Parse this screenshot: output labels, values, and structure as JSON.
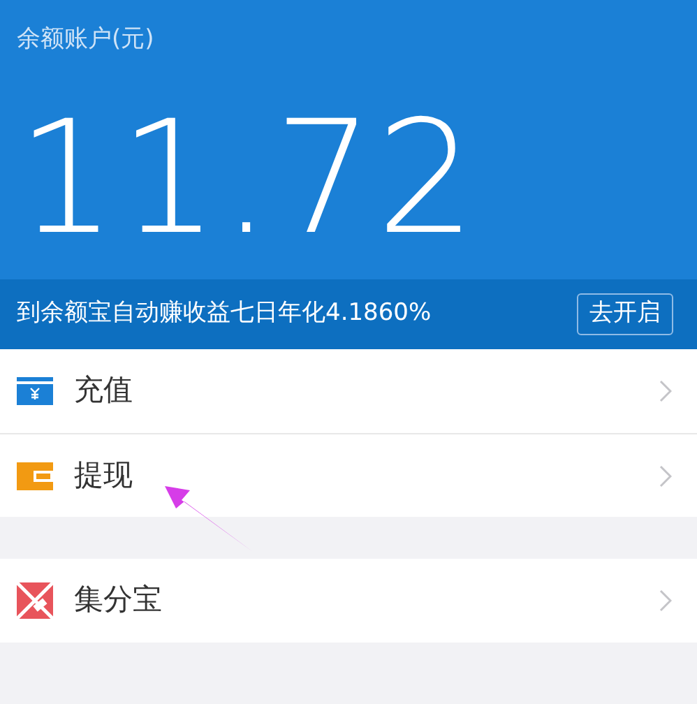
{
  "balance": {
    "label": "余额账户(元)",
    "amount": "11.72"
  },
  "banner": {
    "text": "到余额宝自动赚收益七日年化4.1860%",
    "button": "去开启"
  },
  "groups": [
    {
      "items": [
        {
          "kind": "recharge",
          "label": "充值"
        },
        {
          "kind": "withdraw",
          "label": "提现"
        }
      ]
    },
    {
      "items": [
        {
          "kind": "points",
          "label": "集分宝"
        }
      ]
    }
  ]
}
